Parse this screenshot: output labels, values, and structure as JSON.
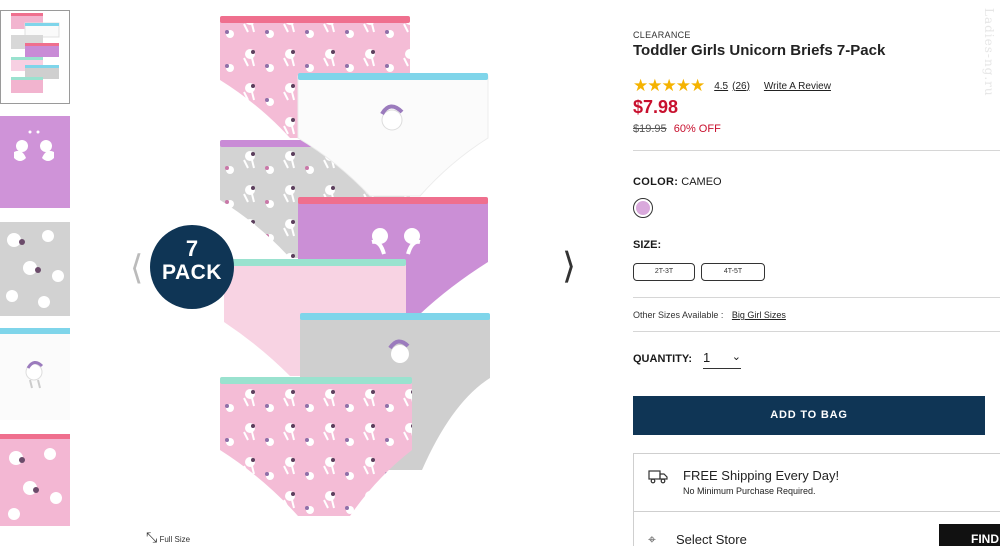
{
  "thumbnails": [
    {
      "name": "thumb-pack",
      "active": true
    },
    {
      "name": "thumb-purple"
    },
    {
      "name": "thumb-grey"
    },
    {
      "name": "thumb-white"
    },
    {
      "name": "thumb-pink"
    }
  ],
  "gallery": {
    "badge_number": "7",
    "badge_word": "PACK",
    "prev_icon": "chevron-left-icon",
    "next_icon": "chevron-right-icon",
    "fullsize_label": "Full Size"
  },
  "product": {
    "tag": "CLEARANCE",
    "title": "Toddler Girls Unicorn Briefs 7-Pack",
    "rating_value": "4.5",
    "review_count": "(26)",
    "write_review": "Write A Review",
    "price": "$7.98",
    "original_price": "$19.95",
    "discount": "60% OFF",
    "color_label": "COLOR:",
    "color_value": "CAMEO",
    "swatch_color": "#d9a9dc",
    "size_label": "SIZE:",
    "sizes": [
      "2T-3T",
      "4T-5T"
    ],
    "other_sizes_label": "Other Sizes Available :",
    "other_sizes_link": "Big Girl Sizes",
    "quantity_label": "QUANTITY:",
    "quantity_value": "1",
    "add_to_bag": "ADD TO BAG"
  },
  "shipping": {
    "title": "FREE Shipping Every Day!",
    "subtitle": "No Minimum Purchase Required.",
    "store_label": "Select Store",
    "find_label": "FIND"
  },
  "colors": {
    "navy": "#0f3555",
    "sale_red": "#c8102e",
    "star_gold": "#f5b301"
  },
  "watermark": "Ladies-ng.ru"
}
